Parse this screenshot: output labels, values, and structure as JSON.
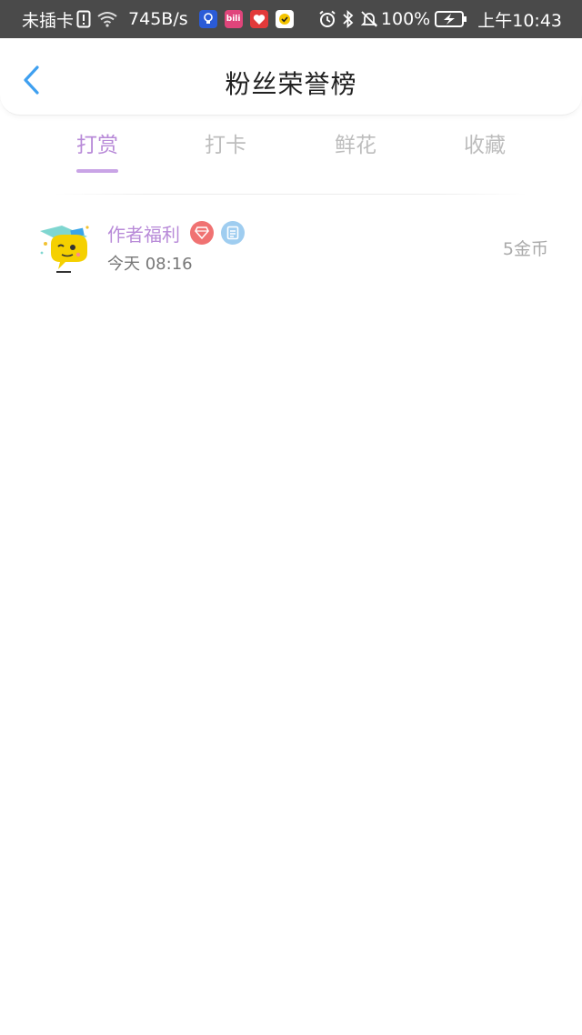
{
  "status_bar": {
    "carrier": "未插卡",
    "speed": "745B/s",
    "battery": "100%",
    "time": "上午10:43",
    "icons": [
      "sim-alert-icon",
      "wifi-icon",
      "lightbulb-app-icon",
      "bilibili-app-icon",
      "heart-app-icon",
      "check-app-icon",
      "alarm-icon",
      "bluetooth-icon",
      "mute-icon",
      "battery-icon"
    ]
  },
  "header": {
    "title": "粉丝荣誉榜",
    "back_icon": "chevron-left-icon",
    "accent_color": "#3fa0f0"
  },
  "tabs": [
    {
      "label": "打赏",
      "active": true
    },
    {
      "label": "打卡",
      "active": false
    },
    {
      "label": "鲜花",
      "active": false
    },
    {
      "label": "收藏",
      "active": false
    }
  ],
  "theme": {
    "active_tab_color": "#b88ad8",
    "inactive_tab_color": "#bdbdbd"
  },
  "list": [
    {
      "name": "作者福利",
      "time": "今天 08:16",
      "amount": "5金币",
      "badges": [
        "gem-badge-icon",
        "document-badge-icon"
      ]
    }
  ]
}
